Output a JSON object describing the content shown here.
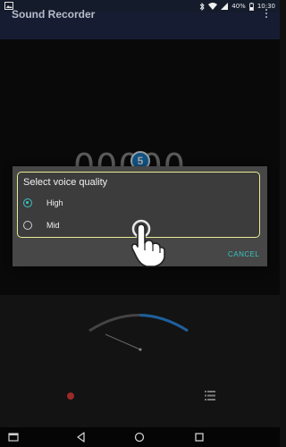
{
  "status_bar": {
    "battery": "40%",
    "time": "10:30"
  },
  "app_bar": {
    "title": "Sound Recorder",
    "menu_icon": "overflow-menu-icon"
  },
  "main": {
    "timer": "00000",
    "step_badge": "5"
  },
  "dialog": {
    "title": "Select voice quality",
    "options": [
      {
        "label": "High",
        "selected": true
      },
      {
        "label": "Mid",
        "selected": false
      }
    ],
    "cancel_label": "CANCEL"
  },
  "colors": {
    "accent": "#37c6c0",
    "record": "#9b2a2a",
    "meter": "#1c5f9e"
  },
  "icons": [
    "gallery-icon",
    "bluetooth-icon",
    "wifi-icon",
    "signal-icon",
    "battery-icon",
    "record-icon",
    "list-icon",
    "back-icon",
    "home-icon",
    "recents-icon",
    "hand-pointer-icon"
  ]
}
